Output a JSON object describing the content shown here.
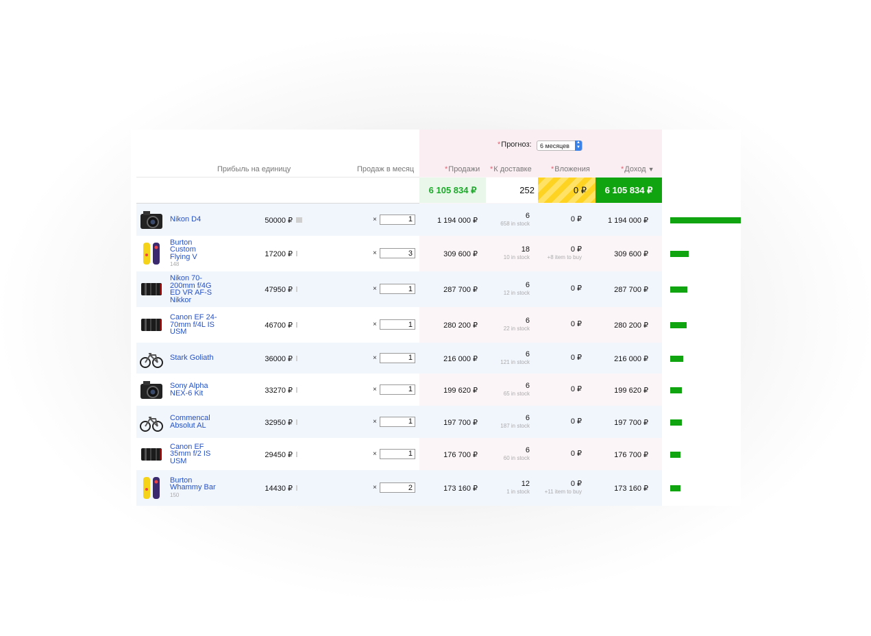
{
  "forecast": {
    "label": "Прогноз:",
    "period": "6 месяцев"
  },
  "headers": {
    "profit_per_unit": "Прибыль на единицу",
    "sales_per_month": "Продаж в месяц",
    "sales": "Продажи",
    "to_delivery": "К доставке",
    "investments": "Вложения",
    "income": "Доход"
  },
  "totals": {
    "sales": "6 105 834 ₽",
    "to_delivery": "252",
    "investments": "0 ₽",
    "income": "6 105 834 ₽"
  },
  "colors": {
    "accent_green": "#10a411",
    "link_blue": "#2350c6",
    "forecast_bg": "#fbeef3",
    "invest_yellow": "#ffd321"
  },
  "rows": [
    {
      "name": "Nikon D4",
      "id": "",
      "icon": "camera-icon",
      "profit": "50000 ₽",
      "qty": "1",
      "sales": "1 194 000 ₽",
      "deliv": "6",
      "stock": "658 in stock",
      "invest": "0 ₽",
      "invest_note": "",
      "income": "1 194 000 ₽",
      "share": 1.0
    },
    {
      "name": "Burton Custom Flying V",
      "id": "148",
      "icon": "snowboard-icon",
      "profit": "17200 ₽",
      "qty": "3",
      "sales": "309 600 ₽",
      "deliv": "18",
      "stock": "10 in stock",
      "invest": "0 ₽",
      "invest_note": "+8 item to buy",
      "income": "309 600 ₽",
      "share": 0.259
    },
    {
      "name": "Nikon 70-200mm f/4G ED VR AF-S Nikkor",
      "id": "",
      "icon": "lens-icon",
      "profit": "47950 ₽",
      "qty": "1",
      "sales": "287 700 ₽",
      "deliv": "6",
      "stock": "12 in stock",
      "invest": "0 ₽",
      "invest_note": "",
      "income": "287 700 ₽",
      "share": 0.241
    },
    {
      "name": "Canon EF 24-70mm f/4L IS USM",
      "id": "",
      "icon": "lens-icon",
      "profit": "46700 ₽",
      "qty": "1",
      "sales": "280 200 ₽",
      "deliv": "6",
      "stock": "22 in stock",
      "invest": "0 ₽",
      "invest_note": "",
      "income": "280 200 ₽",
      "share": 0.235
    },
    {
      "name": "Stark Goliath",
      "id": "",
      "icon": "bicycle-icon",
      "profit": "36000 ₽",
      "qty": "1",
      "sales": "216 000 ₽",
      "deliv": "6",
      "stock": "121 in stock",
      "invest": "0 ₽",
      "invest_note": "",
      "income": "216 000 ₽",
      "share": 0.181
    },
    {
      "name": "Sony Alpha NEX-6 Kit",
      "id": "",
      "icon": "camera-icon",
      "profit": "33270 ₽",
      "qty": "1",
      "sales": "199 620 ₽",
      "deliv": "6",
      "stock": "65 in stock",
      "invest": "0 ₽",
      "invest_note": "",
      "income": "199 620 ₽",
      "share": 0.167
    },
    {
      "name": "Commencal Absolut AL",
      "id": "",
      "icon": "bicycle-icon",
      "profit": "32950 ₽",
      "qty": "1",
      "sales": "197 700 ₽",
      "deliv": "6",
      "stock": "187 in stock",
      "invest": "0 ₽",
      "invest_note": "",
      "income": "197 700 ₽",
      "share": 0.166
    },
    {
      "name": "Canon EF 35mm f/2 IS USM",
      "id": "",
      "icon": "lens-icon",
      "profit": "29450 ₽",
      "qty": "1",
      "sales": "176 700 ₽",
      "deliv": "6",
      "stock": "60 in stock",
      "invest": "0 ₽",
      "invest_note": "",
      "income": "176 700 ₽",
      "share": 0.148
    },
    {
      "name": "Burton Whammy Bar",
      "id": "150",
      "icon": "snowboard-icon",
      "profit": "14430 ₽",
      "qty": "2",
      "sales": "173 160 ₽",
      "deliv": "12",
      "stock": "1 in stock",
      "invest": "0 ₽",
      "invest_note": "+11 item to buy",
      "income": "173 160 ₽",
      "share": 0.145
    }
  ]
}
